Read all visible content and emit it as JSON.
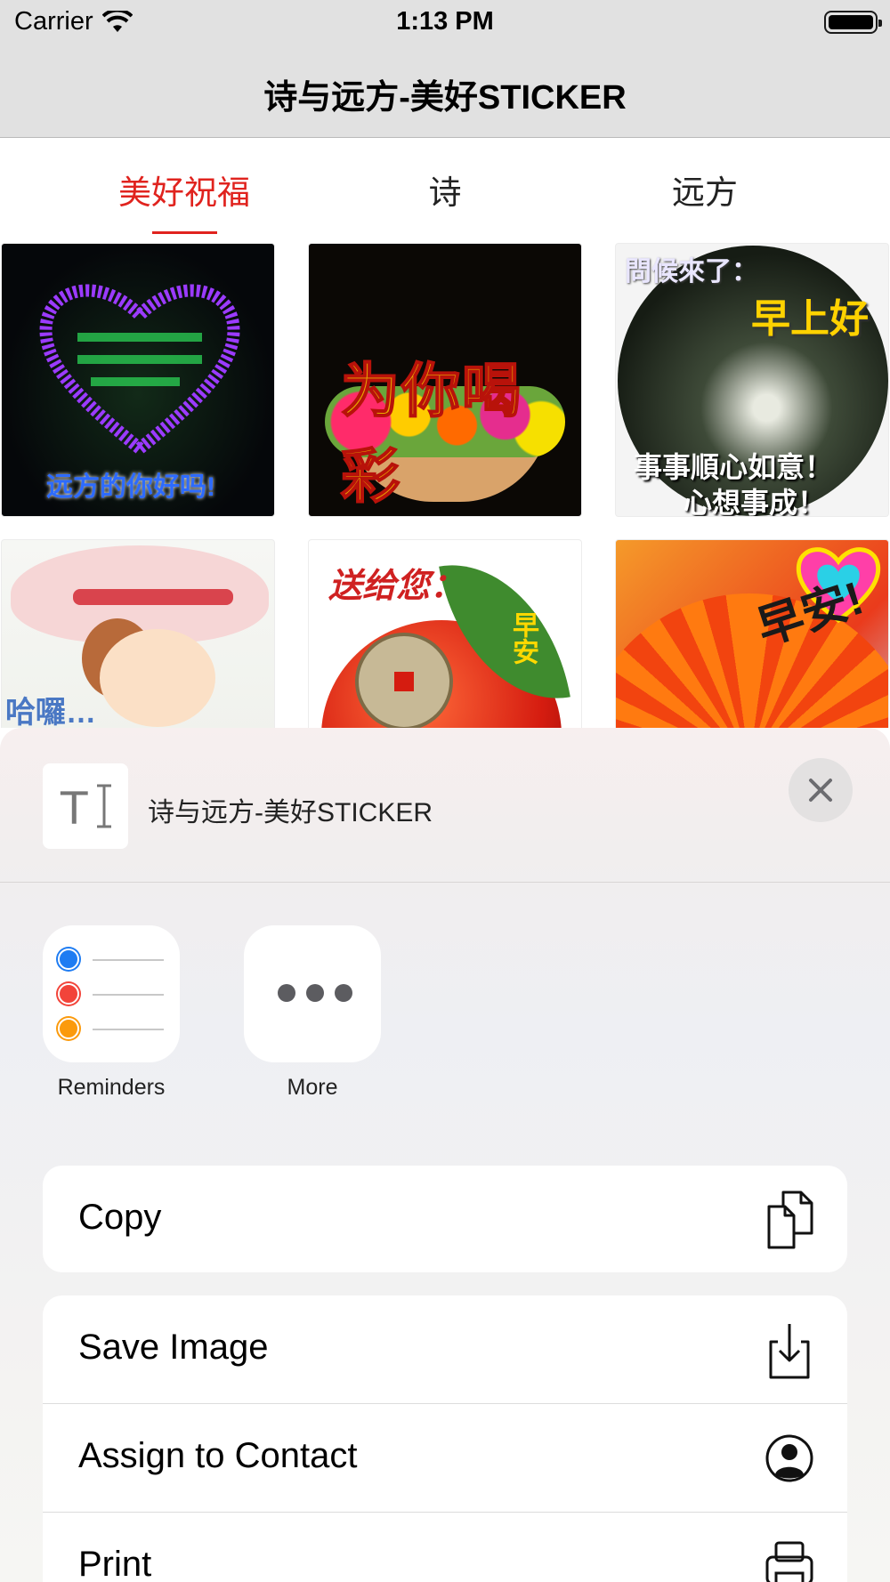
{
  "status_bar": {
    "carrier": "Carrier",
    "time": "1:13 PM",
    "wifi_icon": "wifi-icon",
    "battery_level": 1.0
  },
  "nav": {
    "title": "诗与远方-美好STICKER"
  },
  "tabs": [
    {
      "label": "美好祝福",
      "active": true
    },
    {
      "label": "诗",
      "active": false
    },
    {
      "label": "远方",
      "active": false
    }
  ],
  "accent_color": "#e0231e",
  "stickers": [
    {
      "text": "远方的你好吗!"
    },
    {
      "text": "为你喝彩"
    },
    {
      "text_top": "問候來了：",
      "text_mid": "早上好",
      "text_bottom_1": "事事順心如意！",
      "text_bottom_2": "心想事成！"
    },
    {
      "text": "哈囉…"
    },
    {
      "text_top": "送给您：",
      "text_side": "早安"
    },
    {
      "text": "早安!"
    }
  ],
  "share_sheet": {
    "preview_title": "诗与远方-美好STICKER",
    "preview_icon": "text-cursor-icon",
    "close_icon": "close-icon",
    "apps": [
      {
        "label": "Reminders",
        "icon": "reminders-icon"
      },
      {
        "label": "More",
        "icon": "more-dots-icon"
      }
    ],
    "actions_group_1": [
      {
        "label": "Copy",
        "icon": "copy-icon"
      }
    ],
    "actions_group_2": [
      {
        "label": "Save Image",
        "icon": "save-download-icon"
      },
      {
        "label": "Assign to Contact",
        "icon": "contact-icon"
      },
      {
        "label": "Print",
        "icon": "printer-icon"
      }
    ]
  }
}
